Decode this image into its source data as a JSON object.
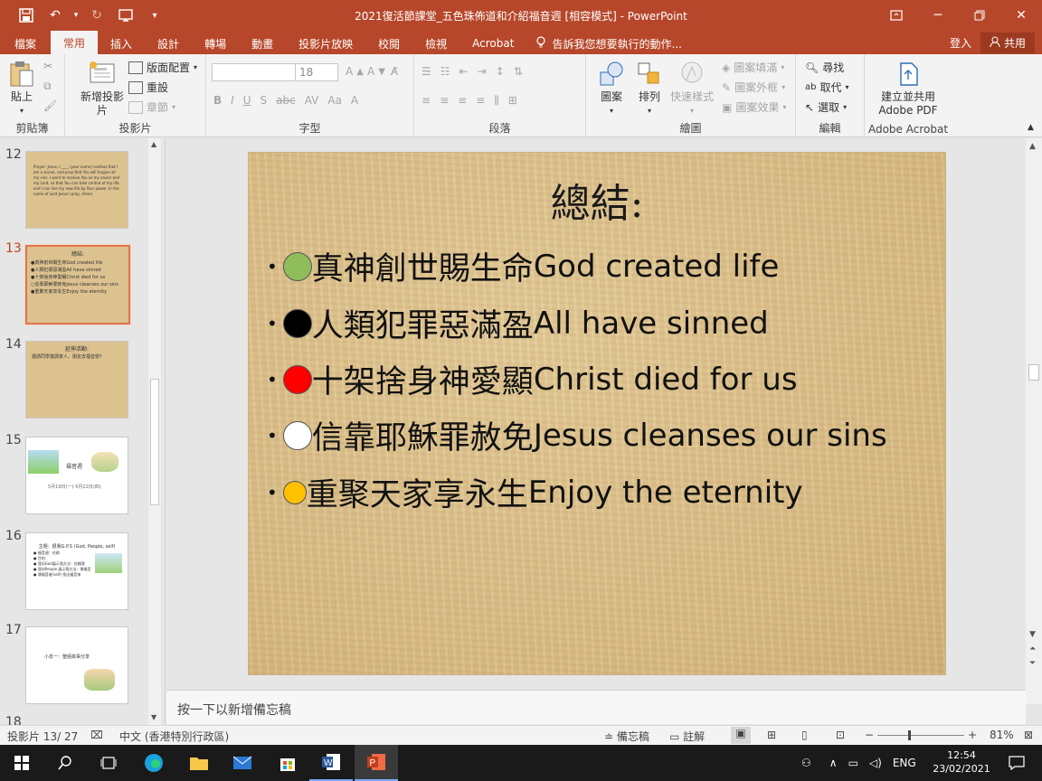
{
  "window": {
    "title": "2021復活節課堂_五色珠佈道和介紹福音週 [相容模式] - PowerPoint"
  },
  "tabs": [
    {
      "label": "檔案",
      "active": false
    },
    {
      "label": "常用",
      "active": true
    },
    {
      "label": "插入",
      "active": false
    },
    {
      "label": "設計",
      "active": false
    },
    {
      "label": "轉場",
      "active": false
    },
    {
      "label": "動畫",
      "active": false
    },
    {
      "label": "投影片放映",
      "active": false
    },
    {
      "label": "校閱",
      "active": false
    },
    {
      "label": "檢視",
      "active": false
    },
    {
      "label": "Acrobat",
      "active": false
    }
  ],
  "tell_me": "告訴我您想要執行的動作...",
  "signin": "登入",
  "share": "共用",
  "ribbon": {
    "clipboard": {
      "paste": "貼上",
      "group": "剪貼簿"
    },
    "slides": {
      "new_slide": "新增投影片",
      "layout": "版面配置",
      "reset": "重設",
      "section": "章節",
      "group": "投影片"
    },
    "font": {
      "font_name": "",
      "font_size": "18",
      "group": "字型"
    },
    "paragraph": {
      "group": "段落"
    },
    "drawing": {
      "shapes": "圖案",
      "arrange": "排列",
      "quick_styles": "快速樣式",
      "fill": "圖案填滿",
      "outline": "圖案外框",
      "effects": "圖案效果",
      "group": "繪圖"
    },
    "editing": {
      "find": "尋找",
      "replace": "取代",
      "select": "選取",
      "group": "編輯"
    },
    "acrobat": {
      "create": "建立並共用",
      "pdf": "Adobe PDF",
      "group": "Adobe Acrobat"
    }
  },
  "thumbnails": [
    {
      "num": "12",
      "text": "Prayer: Jesus, I ____ (your name) confess that I am a sinner, and pray that You will forgive all my sins. I want to receive You as my savior and my Lord, so that You can take control of my life, and I can live my new life by Your power. In the name of Lord Jesus I pray, Amen."
    },
    {
      "num": "13",
      "title": "總結:",
      "lines": [
        "●真神創世賜生命God created life",
        "●人類犯罪惡滿盈All have sinned",
        "●十架捨身神愛顯Christ died for us",
        "○信靠耶穌罪赦免Jesus cleanses our sins",
        "●重聚天家享永生Enjoy the eternity"
      ]
    },
    {
      "num": "14",
      "title": "延伸活動:",
      "text": "邀請同學邀請家人、朋友去福音營?"
    },
    {
      "num": "15",
      "title": "福音週",
      "text": "5月19日(一)-5月22日(四)"
    },
    {
      "num": "16",
      "title": "主題：很我G.P.S (God, People, self)",
      "lines": [
        "● 福音週：任務",
        "● 目的：",
        "● 我向God展示我方法：信賴我",
        "● 我向People 展示我方法：傳福音",
        "● 傳福音者(self) 找出福音來"
      ]
    },
    {
      "num": "17",
      "title": "小息一：聖經故事分享"
    },
    {
      "num": "18"
    }
  ],
  "slide": {
    "title": "總結:",
    "bullets": [
      {
        "zh": "真神創世賜生命",
        "en": "God created life",
        "color": "#8fbd5a"
      },
      {
        "zh": "人類犯罪惡滿盈",
        "en": "All have sinned",
        "color": "#000000"
      },
      {
        "zh": "十架捨身神愛顯",
        "en": "Christ died for us",
        "color": "#ff0000"
      },
      {
        "zh": "信靠耶穌罪赦免",
        "en": "Jesus cleanses our sins",
        "color": "#ffffff"
      },
      {
        "zh": "重聚天家享永生",
        "en": "Enjoy the eternity",
        "color": "#ffc000"
      }
    ]
  },
  "notes_placeholder": "按一下以新增備忘稿",
  "status": {
    "slide_count": "投影片 13/ 27",
    "language": "中文 (香港特別行政區)",
    "notes": "備忘稿",
    "comments": "註解",
    "zoom": "81%"
  },
  "taskbar": {
    "time": "12:54",
    "date": "23/02/2021",
    "lang": "ENG"
  }
}
